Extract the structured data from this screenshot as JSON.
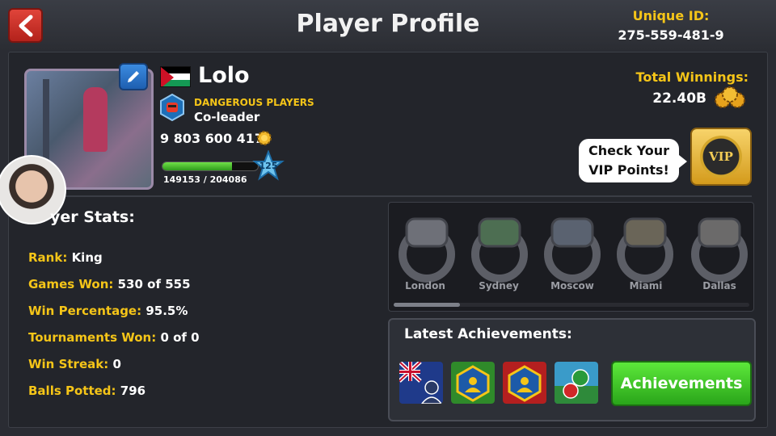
{
  "header": {
    "title": "Player Profile",
    "unique_id_label": "Unique ID:",
    "unique_id_value": "275-559-481-9"
  },
  "player": {
    "name": "Lolo",
    "club_name": "DANGEROUS PLAYERS",
    "club_role": "Co-leader",
    "coins": "9 803 600 417",
    "level": "125",
    "xp": "149153 / 204086",
    "xp_fraction": 0.731
  },
  "winnings": {
    "label": "Total Winnings:",
    "value": "22.40B"
  },
  "vip": {
    "prompt": "Check Your VIP Points!",
    "badge": "VIP"
  },
  "stats": {
    "title": "yer Stats:",
    "rows": [
      {
        "key": "Rank:",
        "value": "King"
      },
      {
        "key": "Games Won:",
        "value": "530 of 555"
      },
      {
        "key": "Win Percentage:",
        "value": "95.5%"
      },
      {
        "key": "Tournaments Won:",
        "value": "0 of 0"
      },
      {
        "key": "Win Streak:",
        "value": "0"
      },
      {
        "key": "Balls Potted:",
        "value": "796"
      }
    ]
  },
  "rings": [
    {
      "label": "London"
    },
    {
      "label": "Sydney"
    },
    {
      "label": "Moscow"
    },
    {
      "label": "Miami"
    },
    {
      "label": "Dallas"
    }
  ],
  "achievements": {
    "title": "Latest Achievements:",
    "button_label": "Achievements",
    "icons": [
      "australia-flag-icon",
      "green-club-icon",
      "red-club-icon",
      "pool-ball-icon"
    ]
  },
  "colors": {
    "accent_yellow": "#f5c518",
    "button_green": "#3cc02a",
    "back_red": "#c9302c"
  }
}
